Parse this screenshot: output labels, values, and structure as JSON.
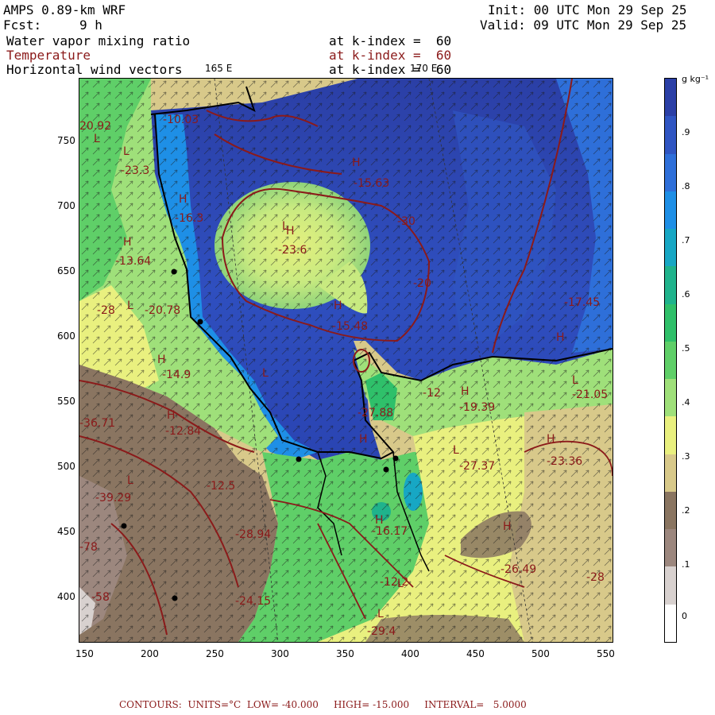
{
  "header": {
    "model": "AMPS 0.89-km WRF",
    "fcst_label": "Fcst:",
    "fcst_value": "9 h",
    "init": "Init: 00 UTC Mon 29 Sep 25",
    "valid": "Valid: 09 UTC Mon 29 Sep 25"
  },
  "fields": [
    {
      "name": "Water vapor mixing ratio",
      "level": "at k-index =  60",
      "color": "#000000"
    },
    {
      "name": "Temperature",
      "level": "at k-index =  60",
      "color": "#8b1a1a"
    },
    {
      "name": "Horizontal wind vectors",
      "level": "at k-index =  60",
      "color": "#000000"
    }
  ],
  "map": {
    "lon_labels": [
      "165 E",
      "170 E"
    ],
    "x_ticks": [
      "150",
      "200",
      "250",
      "300",
      "350",
      "400",
      "450",
      "500",
      "550"
    ],
    "y_ticks": [
      "750",
      "700",
      "650",
      "600",
      "550",
      "500",
      "450",
      "400"
    ],
    "temp_labels": [
      "20.92",
      "-10.03",
      "-23.3",
      "-16.3",
      "-13.64",
      "-28",
      "-20.78",
      "-14.9",
      "-15.63",
      "-30",
      "-23.6",
      "-20",
      "-15.48",
      "-17.45",
      "-12",
      "-19.39",
      "-21.05",
      "-27.88",
      "-12.84",
      "-36.71",
      "-23.36",
      "-27.37",
      "-12.5",
      "-39.29",
      "-28.94",
      "-16.17",
      "-78",
      "-12.2",
      "-26.49",
      "-28",
      "-58",
      "-24.15",
      "-29.4"
    ],
    "hl_labels": [
      "L",
      "L",
      "H",
      "H",
      "L",
      "H",
      "H",
      "L",
      "H",
      "L",
      "H",
      "H",
      "H",
      "L",
      "H",
      "H",
      "L",
      "H",
      "L",
      "H",
      "L",
      "H",
      "L"
    ]
  },
  "colorbar": {
    "unit": "g kg⁻¹",
    "labels": [
      ".9",
      ".8",
      ".7",
      ".6",
      ".5",
      ".4",
      ".3",
      ".2",
      ".1",
      "0"
    ],
    "colors": [
      "#2b3fa6",
      "#2f55c2",
      "#2e6fd9",
      "#1e8fe6",
      "#17a7c4",
      "#1fb38c",
      "#2fc06a",
      "#5fcf68",
      "#9fe07a",
      "#e9f07f",
      "#d8c98a",
      "#8a7561",
      "#9c877e",
      "#d8d1cf",
      "#ffffff"
    ]
  },
  "footer": "CONTOURS:  UNITS=°C  LOW= -40.000     HIGH= -15.000     INTERVAL=   5.0000"
}
